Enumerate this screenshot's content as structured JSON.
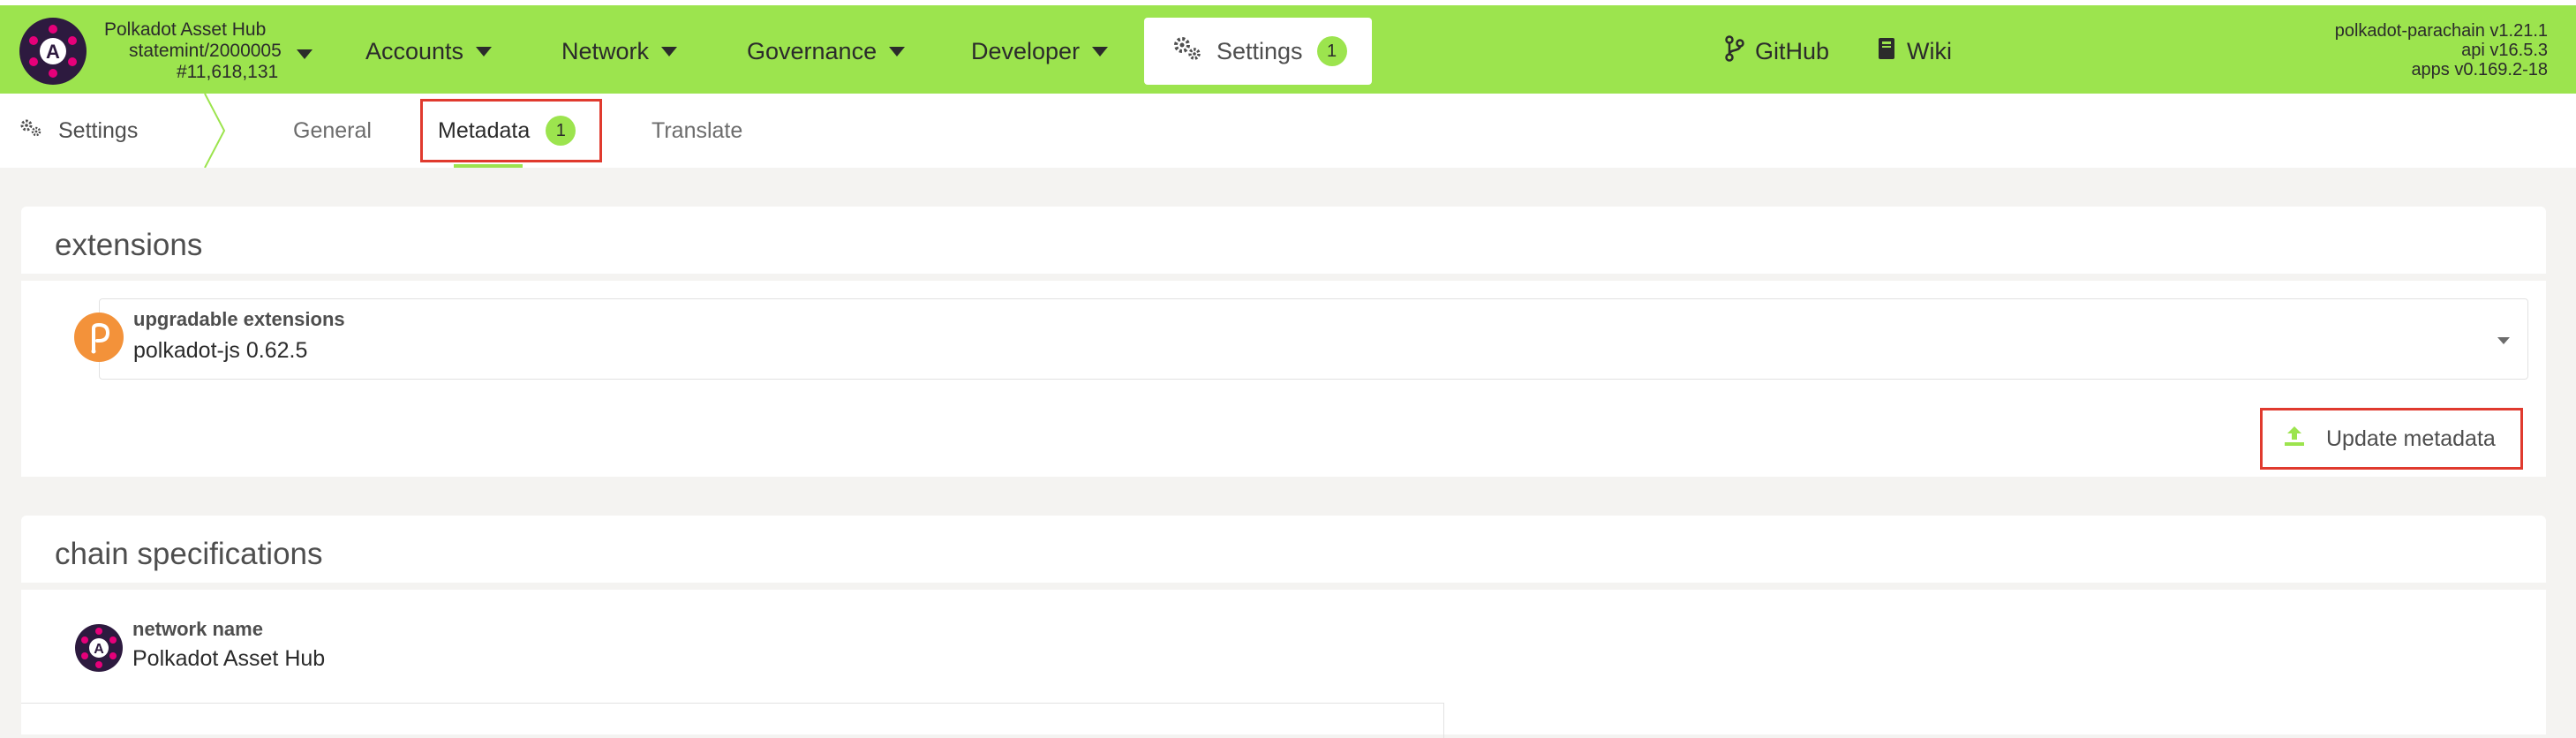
{
  "header": {
    "chain_name": "Polkadot Asset Hub",
    "chain_id": "statemint/2000005",
    "block_number": "#11,618,131",
    "nav": [
      {
        "label": "Accounts"
      },
      {
        "label": "Network"
      },
      {
        "label": "Governance"
      },
      {
        "label": "Developer"
      }
    ],
    "settings_label": "Settings",
    "settings_badge": "1",
    "github_label": "GitHub",
    "wiki_label": "Wiki",
    "version_runtime": "polkadot-parachain v1.21.1",
    "version_api": "api v16.5.3",
    "version_apps": "apps v0.169.2-18"
  },
  "subnav": {
    "home_label": "Settings",
    "tabs": [
      {
        "label": "General"
      },
      {
        "label": "Metadata",
        "badge": "1"
      },
      {
        "label": "Translate"
      }
    ]
  },
  "extensions": {
    "title": "extensions",
    "field_label": "upgradable extensions",
    "field_value": "polkadot-js 0.62.5",
    "button_label": "Update metadata"
  },
  "chain_specs": {
    "title": "chain specifications",
    "network_label": "network name",
    "network_value": "Polkadot Asset Hub"
  },
  "colors": {
    "accent": "#9ce44e",
    "highlight": "#e03a2e",
    "extension_icon": "#f3923a",
    "logo": "#2d1a3f"
  }
}
